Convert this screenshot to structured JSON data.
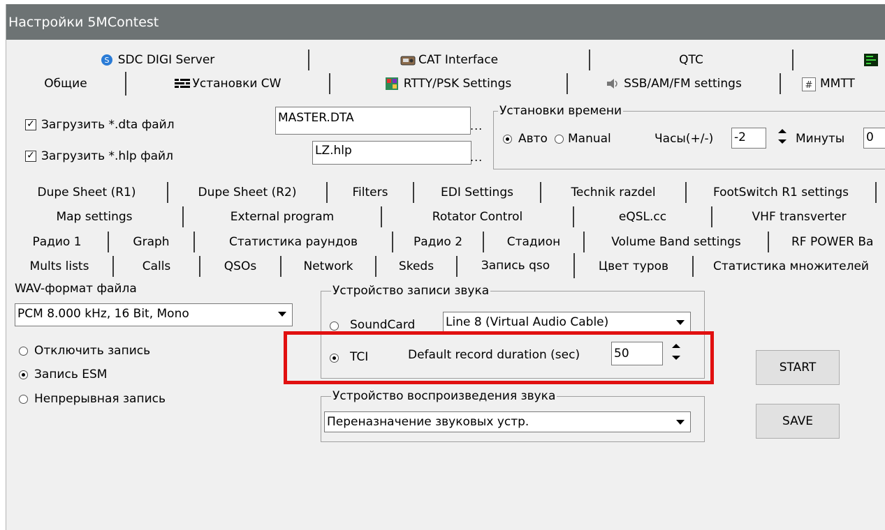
{
  "window": {
    "title": "Настройки 5MContest"
  },
  "tabs_row1": [
    {
      "label": "SDC DIGI Server",
      "icon": "sdc-icon"
    },
    {
      "label": "CAT Interface",
      "icon": "radio-icon"
    },
    {
      "label": "QTC"
    },
    {
      "label": "",
      "icon": "terminal-icon"
    }
  ],
  "tabs_row2": [
    {
      "label": "Общие"
    },
    {
      "label": "Установки CW",
      "icon": "cw-icon"
    },
    {
      "label": "RTTY/PSK Settings",
      "icon": "rtty-icon"
    },
    {
      "label": "SSB/AM/FM settings",
      "icon": "speaker-icon"
    },
    {
      "label": "MMTT",
      "icon": "mmtty-icon"
    }
  ],
  "general": {
    "load_dta_label": "Загрузить *.dta файл",
    "load_dta_checked": true,
    "dta_file": "MASTER.DTA",
    "load_hlp_label": "Загрузить *.hlp файл",
    "load_hlp_checked": true,
    "hlp_file": "LZ.hlp",
    "browse": "...",
    "time_group": "Установки времени",
    "auto_label": "Авто",
    "manual_label": "Manual",
    "hours_label": "Часы(+/-)",
    "hours_value": "-2",
    "minutes_label": "Минуты",
    "minutes_value": "0"
  },
  "subtabs_row1": [
    "Dupe Sheet (R1)",
    "Dupe Sheet (R2)",
    "Filters",
    "EDI Settings",
    "Technik razdel",
    "FootSwitch R1 settings"
  ],
  "subtabs_row2": [
    "Map settings",
    "External program",
    "Rotator Control",
    "eQSL.cc",
    "VHF transverter"
  ],
  "subtabs_row3": [
    "Радио 1",
    "Graph",
    "Статистика раундов",
    "Радио 2",
    "Стадион",
    "Volume Band settings",
    "RF POWER Ba"
  ],
  "subtabs_row4": [
    "Mults lists",
    "Calls",
    "QSOs",
    "Network",
    "Skeds",
    "Запись qso",
    "Цвет туров",
    "Статистика множителей"
  ],
  "record": {
    "wav_format_label": "WAV-формат файла",
    "wav_format_value": "PCM 8.000 kHz, 16 Bit, Mono",
    "disable_label": "Отключить запись",
    "esm_label": "Запись ESM",
    "continuous_label": "Непрерывная запись",
    "mode_selected": "esm",
    "device_group": "Устройство записи звука",
    "soundcard_label": "SoundCard",
    "soundcard_value": "Line 8 (Virtual Audio Cable)",
    "tci_label": "TCI",
    "tci_selected": true,
    "duration_label": "Default record duration (sec)",
    "duration_value": "50",
    "playback_group": "Устройство воспроизведения звука",
    "playback_value": "Переназначение звуковых устр.",
    "start_label": "START",
    "save_label": "SAVE"
  },
  "colors": {
    "title_bg": "#6d7374",
    "highlight": "#e11010"
  }
}
